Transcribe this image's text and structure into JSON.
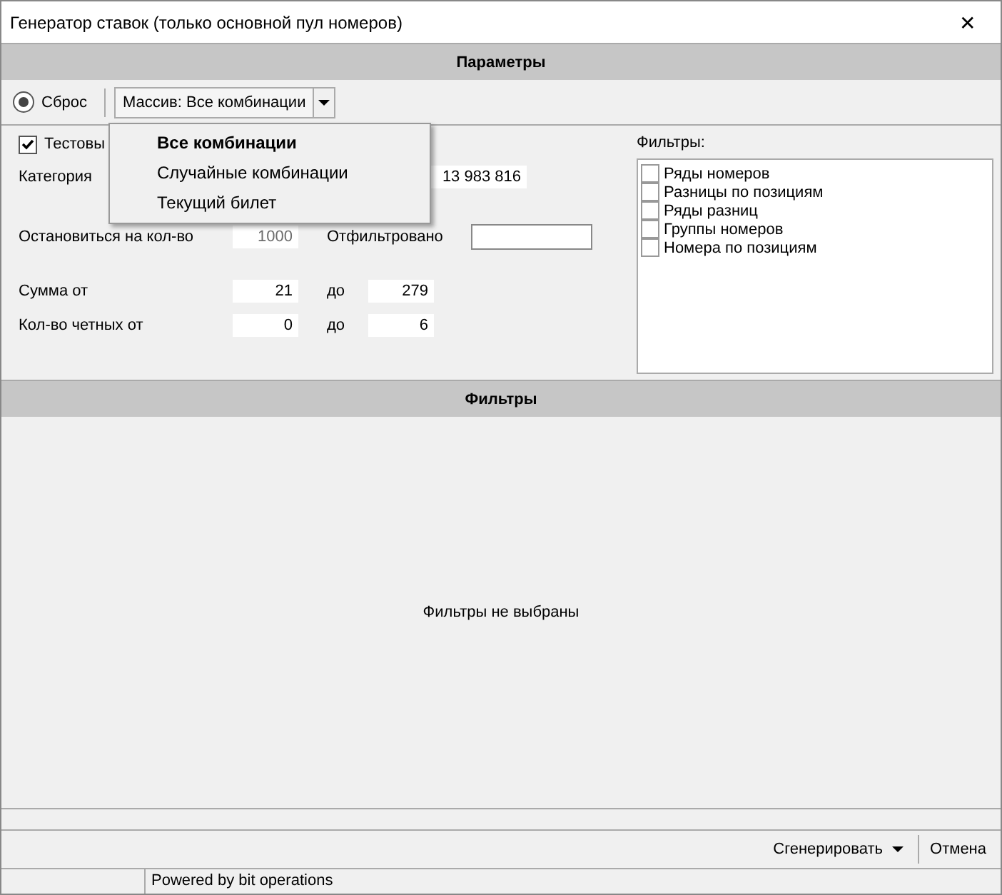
{
  "window": {
    "title": "Генератор ставок (только основной пул номеров)",
    "close": "✕"
  },
  "params_header": "Параметры",
  "toolbar": {
    "reset": {
      "label": "Сброс",
      "selected": true
    },
    "array_button": "Массив: Все комбинации"
  },
  "menu": {
    "items": [
      {
        "label": "Все комбинации",
        "selected": true
      },
      {
        "label": "Случайные комбинации",
        "selected": false
      },
      {
        "label": "Текущий билет",
        "selected": false
      }
    ]
  },
  "test_checkbox": {
    "label": "Тестовы",
    "checked": true
  },
  "category": {
    "label": "Категория",
    "value": "13 983 816"
  },
  "stop": {
    "label": "Остановиться на кол-во",
    "value": "1000",
    "filtered_label": "Отфильтровано"
  },
  "sum": {
    "label": "Сумма от",
    "from": "21",
    "to_label": "до",
    "to": "279"
  },
  "even": {
    "label": "Кол-во четных от",
    "from": "0",
    "to_label": "до",
    "to": "6"
  },
  "filters": {
    "label": "Фильтры:",
    "items": [
      {
        "label": "Ряды номеров",
        "checked": false
      },
      {
        "label": "Разницы по позициям",
        "checked": false
      },
      {
        "label": "Ряды разниц",
        "checked": false
      },
      {
        "label": "Группы номеров",
        "checked": false
      },
      {
        "label": "Номера по позициям",
        "checked": false
      }
    ]
  },
  "filters_header": "Фильтры",
  "empty_message": "Фильтры не выбраны",
  "buttons": {
    "generate": "Сгенерировать",
    "cancel": "Отмена"
  },
  "status_bar": {
    "text": "Powered by bit operations"
  }
}
